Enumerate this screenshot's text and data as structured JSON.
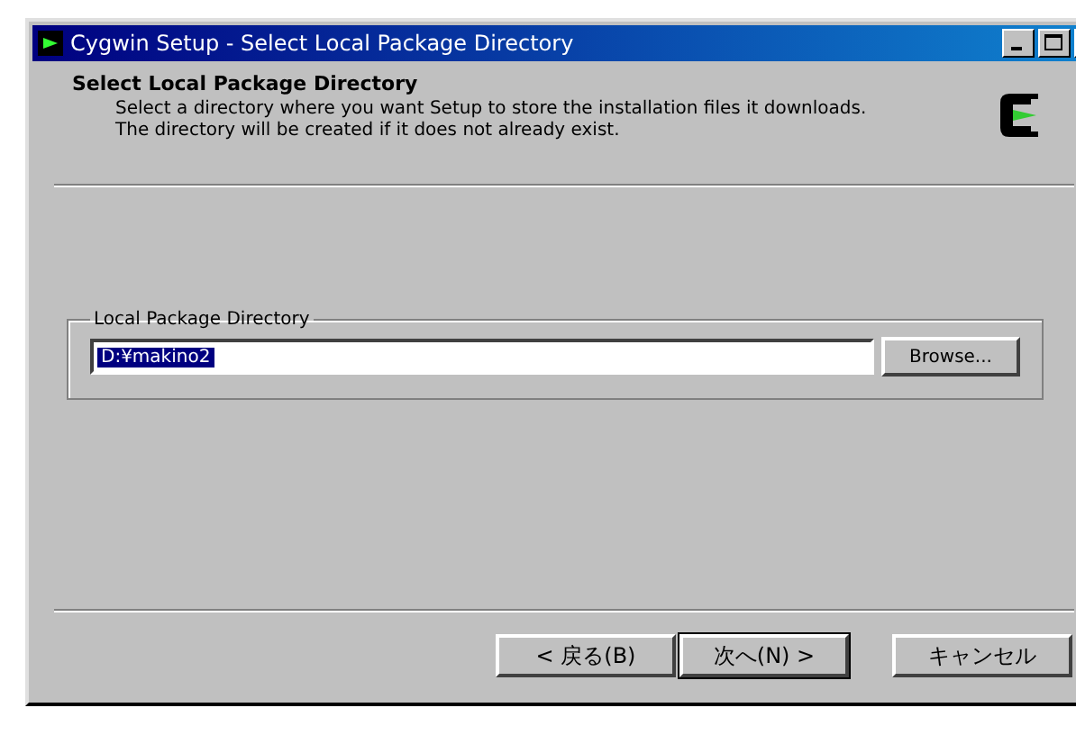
{
  "window": {
    "title": "Cygwin Setup - Select Local Package Directory"
  },
  "header": {
    "title": "Select Local Package Directory",
    "description": "Select a directory where you want Setup to store the installation files it downloads.  The directory will be created if it does not already exist."
  },
  "group": {
    "label": "Local Package Directory",
    "field": {
      "value": "D:¥makino2",
      "value_selected": true
    },
    "browse_button": "Browse..."
  },
  "buttons": [
    {
      "label": "< 戻る(B)",
      "default": false
    },
    {
      "label": "次へ(N) >",
      "default": true
    },
    {
      "label": "キャンセル",
      "default": false
    }
  ]
}
